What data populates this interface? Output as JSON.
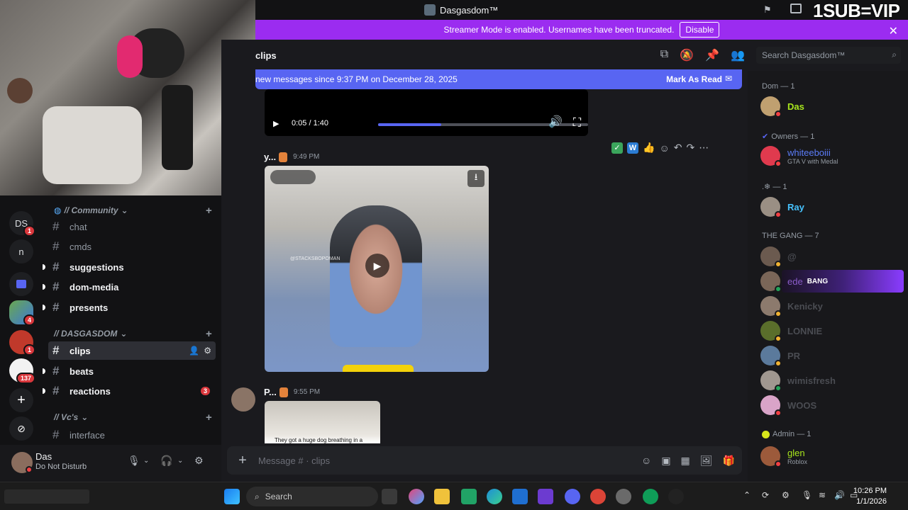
{
  "window": {
    "title": "Dasgasdom™",
    "overlay_text": "1SUB=VIP"
  },
  "banner": {
    "text": "Streamer Mode is enabled. Usernames have been truncated.",
    "button": "Disable"
  },
  "rail": {
    "servers": [
      {
        "label": "DS",
        "badge": "1"
      },
      {
        "label": "n"
      }
    ],
    "badges": [
      "4",
      "1",
      "137"
    ]
  },
  "channels": {
    "categories": [
      {
        "name": "// Community"
      },
      {
        "name": "// DASGASDOM"
      },
      {
        "name": "// Vc's"
      }
    ],
    "items": [
      {
        "name": "chat",
        "state": "muted"
      },
      {
        "name": "cmds",
        "state": "muted"
      },
      {
        "name": "suggestions",
        "state": "unread"
      },
      {
        "name": "dom-media",
        "state": "unread"
      },
      {
        "name": "presents",
        "state": "unread"
      },
      {
        "name": "clips",
        "state": "active"
      },
      {
        "name": "beats",
        "state": "unread"
      },
      {
        "name": "reactions",
        "state": "unread",
        "badge": "3"
      },
      {
        "name": "interface",
        "state": "muted"
      }
    ]
  },
  "user_panel": {
    "name": "Das",
    "status": "Do Not Disturb"
  },
  "chat": {
    "channel_name": "clips",
    "new_messages": "new messages since 9:37 PM on December 28, 2025",
    "mark_as_read": "Mark As Read",
    "video1_time": "0:05 / 1:40",
    "messages": [
      {
        "author": "y...",
        "time": "9:49 PM",
        "handle": "@STACKSBOPOMAN"
      },
      {
        "author": "P...",
        "time": "9:55 PM",
        "caption": "They got a huge dog breathing in a"
      }
    ],
    "composer_placeholder": "Message # · clips"
  },
  "search": {
    "placeholder": "Search Dasgasdom™"
  },
  "members": {
    "groups": [
      {
        "label": "Dom — 1"
      },
      {
        "label": "Owners — 1"
      },
      {
        "label": ".❄ — 1"
      },
      {
        "label": "THE GANG — 7"
      },
      {
        "label": "Admin — 1"
      }
    ],
    "people": [
      {
        "name": "Das",
        "color": "#a8e61d",
        "status_color": "#f23f43"
      },
      {
        "name": "whiteeboiii",
        "color": "#5b7cf7",
        "activity": "GTA V with Medal",
        "status_color": "#f23f43"
      },
      {
        "name": "Ray",
        "color": "#46c2ff",
        "status_color": "#f23f43"
      },
      {
        "name": "@",
        "color": "#4a4c52",
        "status_color": "#f0b232"
      },
      {
        "name": "ede",
        "color": "#8a5cc9",
        "tag": "BANG",
        "status_color": "#23a55a"
      },
      {
        "name": "Kenicky",
        "color": "#4a4c52",
        "status_color": "#f0b232"
      },
      {
        "name": "LONNIE",
        "color": "#4a4c52",
        "status_color": "#f0b232"
      },
      {
        "name": "PR",
        "color": "#4a4c52",
        "status_color": "#f0b232"
      },
      {
        "name": "wimisfresh",
        "color": "#4a4c52",
        "status_color": "#23a55a"
      },
      {
        "name": "WOOS",
        "color": "#4a4c52",
        "status_color": "#f23f43"
      },
      {
        "name": "glen",
        "color": "#a8e61d",
        "activity": "Roblox",
        "status_color": "#f23f43"
      }
    ]
  },
  "taskbar": {
    "search": "Search",
    "time": "10:26 PM",
    "date": "1/1/2026"
  },
  "colors": {
    "accent": "#5865f2",
    "banner": "#9b2cf0",
    "dnd": "#f23f43"
  }
}
